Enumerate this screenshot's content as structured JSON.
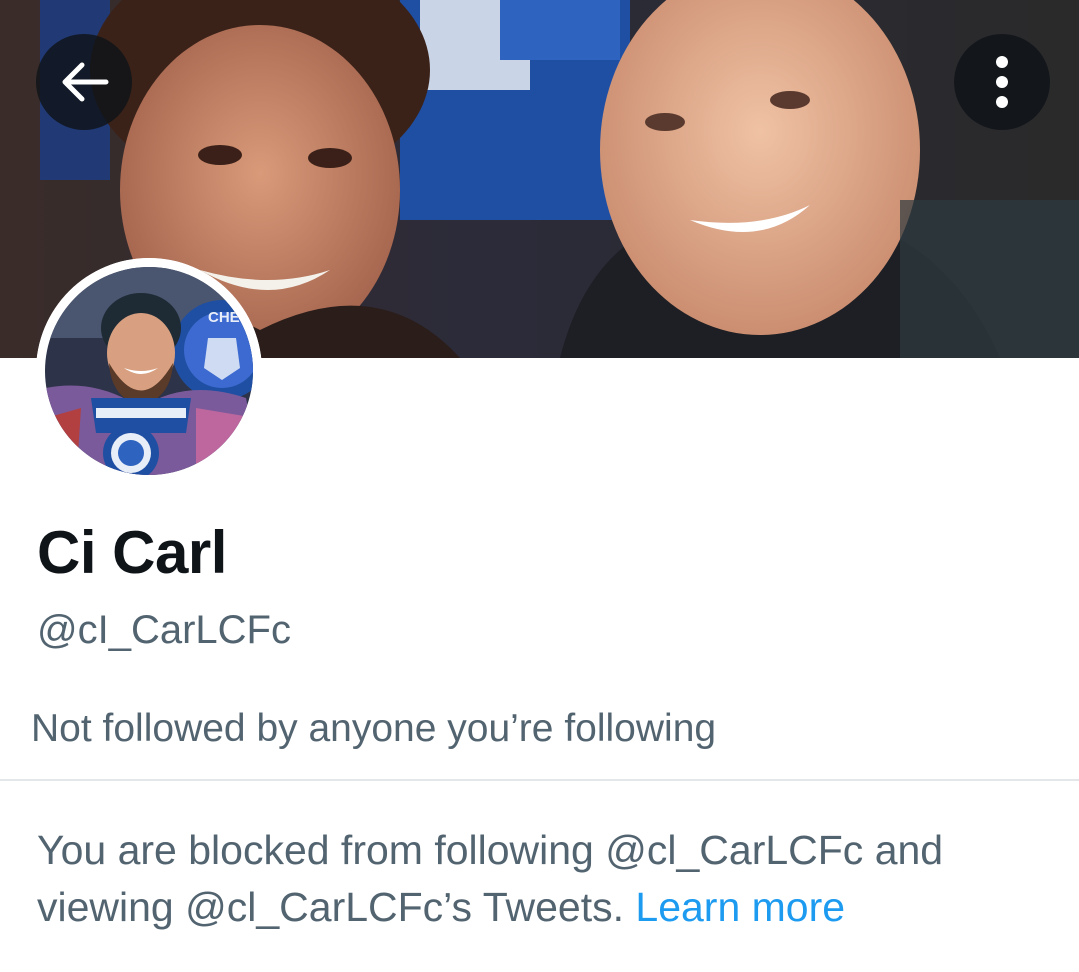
{
  "header": {
    "back_icon": "arrow-left-icon",
    "more_icon": "more-vertical-icon",
    "button_background": "#0f1419"
  },
  "profile": {
    "display_name": "Ci Carl",
    "handle": "@cI_CarLCFc",
    "followers_note": "Not followed by anyone you’re following"
  },
  "blocked_notice": {
    "text_line1": "You are blocked from following @cl_CarLCFc and",
    "text_line2": "viewing @cl_CarLCFc’s Tweets.",
    "link_label": "Learn more",
    "link_color": "#1d9bf0"
  },
  "avatar": {
    "badge_text": "CHE"
  },
  "colors": {
    "text_primary": "#0f1419",
    "text_secondary": "#536471",
    "divider": "#e3e7ea"
  }
}
